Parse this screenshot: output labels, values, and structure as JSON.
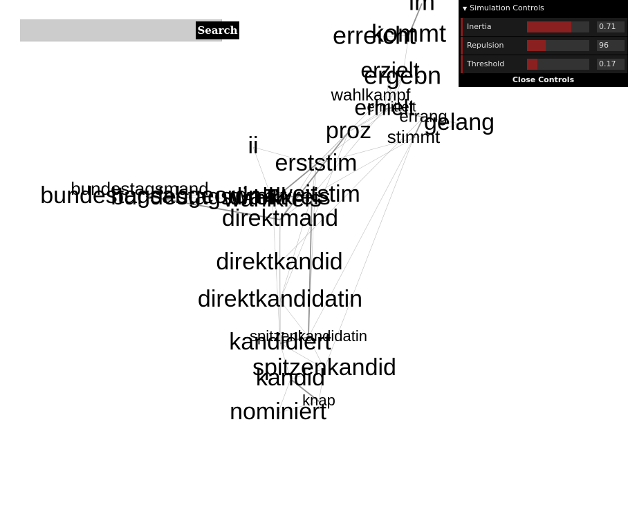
{
  "search": {
    "value": "",
    "placeholder": "",
    "button_label": "Search"
  },
  "controls": {
    "title": "Simulation Controls",
    "close_label": "Close Controls",
    "params": [
      {
        "name": "Inertia",
        "value": "0.71",
        "level": 0.71
      },
      {
        "name": "Repulsion",
        "value": "96",
        "level": 0.3
      },
      {
        "name": "Threshold",
        "value": "0.17",
        "level": 0.17
      }
    ]
  },
  "graph": {
    "edge_color": "#888888",
    "label_color": "#000000",
    "words": [
      "im",
      "erreicht",
      "kommt",
      "erzielt",
      "ergebn",
      "wahlkampf",
      "ermittelt",
      "erhielt",
      "gelang",
      "errang",
      "proz",
      "stimmt",
      "ii",
      "erststim",
      "bundestagsmand",
      "bundestagsabgeordn",
      "bundestagswahlkreis",
      "wahlkreis",
      "direkt",
      "zweitstim",
      "direktmand",
      "direktkandid",
      "direktkandidatin",
      "spitzenkandidatin",
      "kandidiert",
      "spitzenkandid",
      "kandid",
      "knap",
      "nominiert"
    ]
  }
}
